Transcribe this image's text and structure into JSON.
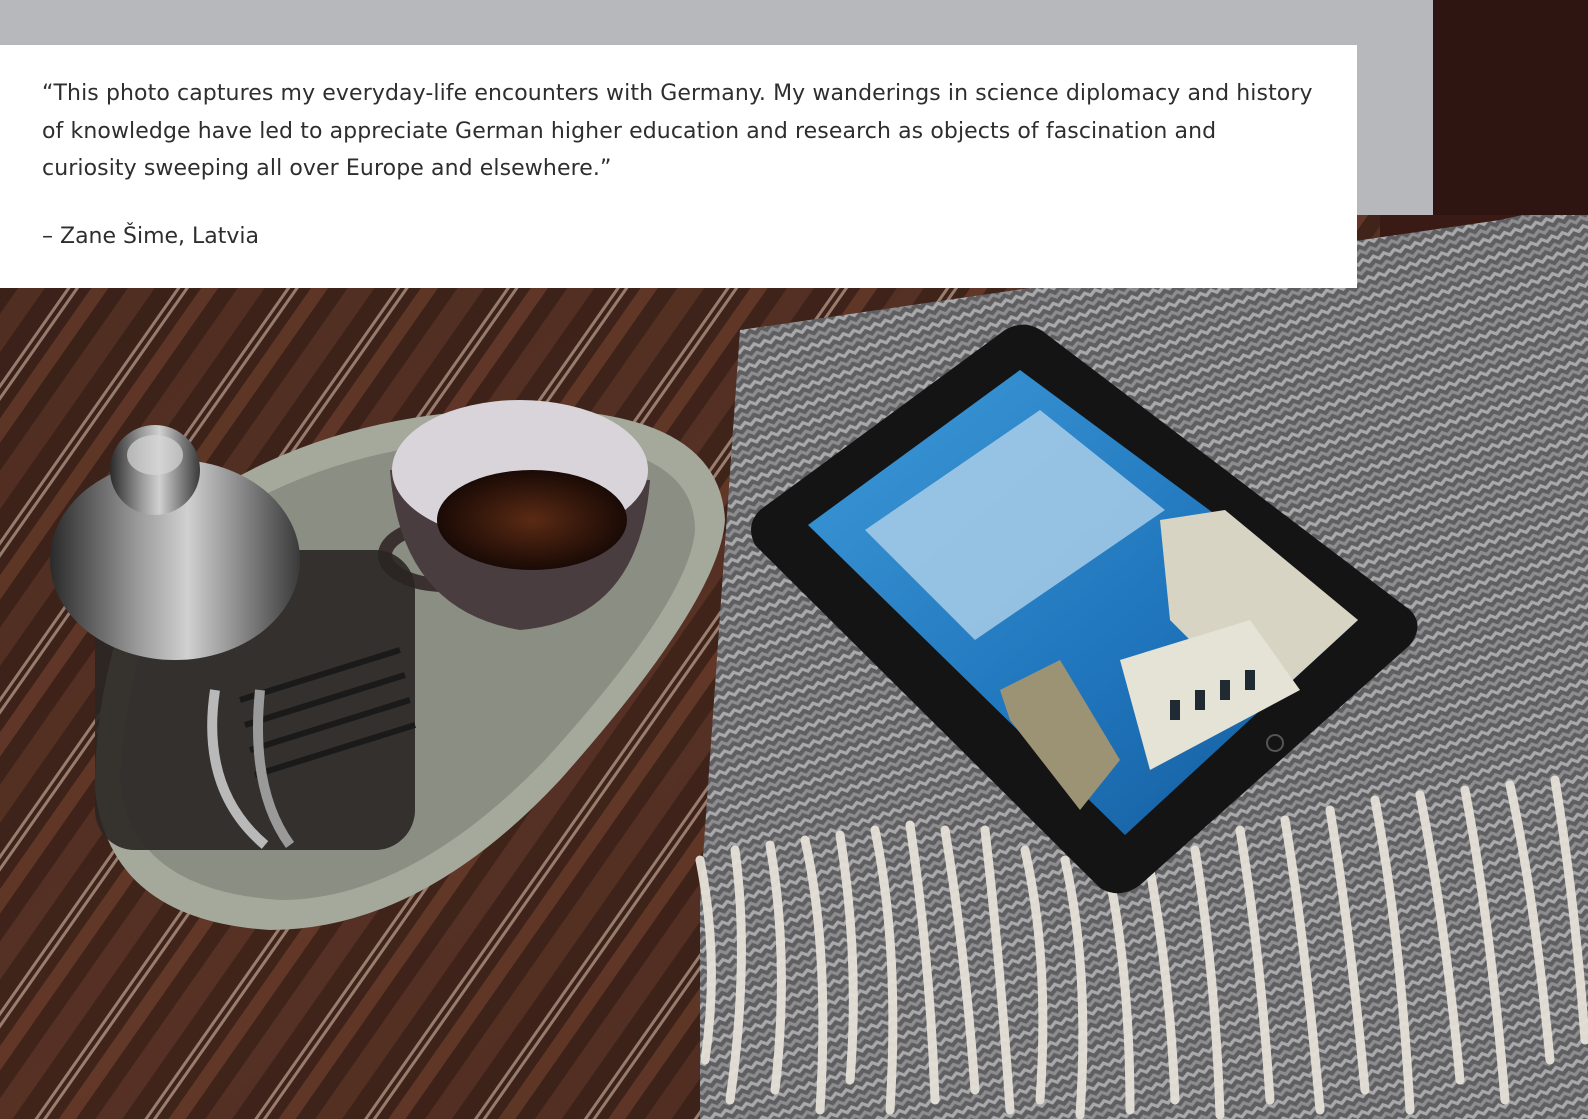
{
  "quote": {
    "text": "“This photo captures my everyday-life encounters with Germany. My wanderings in science diplomacy and history of knowledge have led to appreciate German higher education and research as objects of fascination and curiosity sweeping all over Europe and elsewhere.”",
    "author": "– Zane Šime, Latvia"
  },
  "colors": {
    "gray_band": "#b7b8bc",
    "card": "#ffffff",
    "text": "#2e2e2e",
    "background_brown": "#3a2016"
  }
}
